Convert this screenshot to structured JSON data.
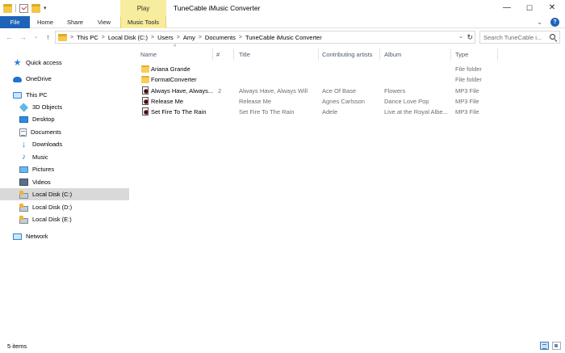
{
  "window": {
    "title": "TuneCable iMusic Converter",
    "context_tab": "Play",
    "minimize_glyph": "—",
    "maximize_glyph": "☐",
    "close_glyph": "✕"
  },
  "quick_access_toolbar": {
    "dropdown_glyph": "▾"
  },
  "ribbon": {
    "tabs": [
      "File",
      "Home",
      "Share",
      "View",
      "Music Tools"
    ],
    "collapse_glyph": "⌄",
    "help_glyph": "?"
  },
  "navigation": {
    "back_glyph": "←",
    "forward_glyph": "→",
    "recent_glyph": "⌄",
    "up_glyph": "↑"
  },
  "address_bar": {
    "crumbs": [
      "This PC",
      "Local Disk (C:)",
      "Users",
      "Amy",
      "Documents",
      "TuneCable iMusic Converter"
    ],
    "separator_glyph": ">",
    "dropdown_glyph": "⌄",
    "refresh_glyph": "↻"
  },
  "search": {
    "placeholder": "Search TuneCable i..."
  },
  "nav_pane": {
    "items": [
      {
        "label": "Quick access",
        "icon": "quick-access-star-icon"
      },
      {
        "label": "OneDrive",
        "icon": "onedrive-cloud-icon"
      },
      {
        "label": "This PC",
        "icon": "this-pc-icon"
      },
      {
        "label": "3D Objects",
        "icon": "3d-objects-icon"
      },
      {
        "label": "Desktop",
        "icon": "desktop-icon"
      },
      {
        "label": "Documents",
        "icon": "documents-icon"
      },
      {
        "label": "Downloads",
        "icon": "downloads-arrow-icon"
      },
      {
        "label": "Music",
        "icon": "music-note-icon"
      },
      {
        "label": "Pictures",
        "icon": "pictures-icon"
      },
      {
        "label": "Videos",
        "icon": "videos-icon"
      },
      {
        "label": "Local Disk (C:)",
        "icon": "local-disk-icon",
        "selected": true
      },
      {
        "label": "Local Disk (D:)",
        "icon": "local-disk-icon"
      },
      {
        "label": "Local Disk (E:)",
        "icon": "local-disk-icon"
      },
      {
        "label": "Network",
        "icon": "network-icon"
      }
    ],
    "star_glyph": "★",
    "download_glyph": "↓",
    "music_glyph": "♪"
  },
  "file_list": {
    "sort_glyph": "^",
    "columns": [
      "Name",
      "#",
      "Title",
      "Contributing artists",
      "Album",
      "Type"
    ],
    "rows": [
      {
        "name": "Ariana Grande",
        "track": "",
        "title": "",
        "artist": "",
        "album": "",
        "type": "File folder",
        "kind": "folder"
      },
      {
        "name": "FormatConverter",
        "track": "",
        "title": "",
        "artist": "",
        "album": "",
        "type": "File folder",
        "kind": "folder"
      },
      {
        "name": "Always Have, Always...",
        "track": "2",
        "title": "Always Have, Always Will",
        "artist": "Ace Of Base",
        "album": "Flowers",
        "type": "MP3 File",
        "kind": "mp3"
      },
      {
        "name": "Release Me",
        "track": "",
        "title": "Release Me",
        "artist": "Agnes Carlsson",
        "album": "Dance Love Pop",
        "type": "MP3 File",
        "kind": "mp3"
      },
      {
        "name": "Set Fire To The Rain",
        "track": "",
        "title": "Set Fire To The Rain",
        "artist": "Adele",
        "album": "Live at the Royal Albe...",
        "type": "MP3 File",
        "kind": "mp3"
      }
    ]
  },
  "status_bar": {
    "item_count": "5 items"
  },
  "colors": {
    "file_tab": "#1e63b8",
    "music_tools_tab": "#f8ec9e",
    "selection": "#d9d9d9",
    "header_text": "#4d5a6b"
  }
}
